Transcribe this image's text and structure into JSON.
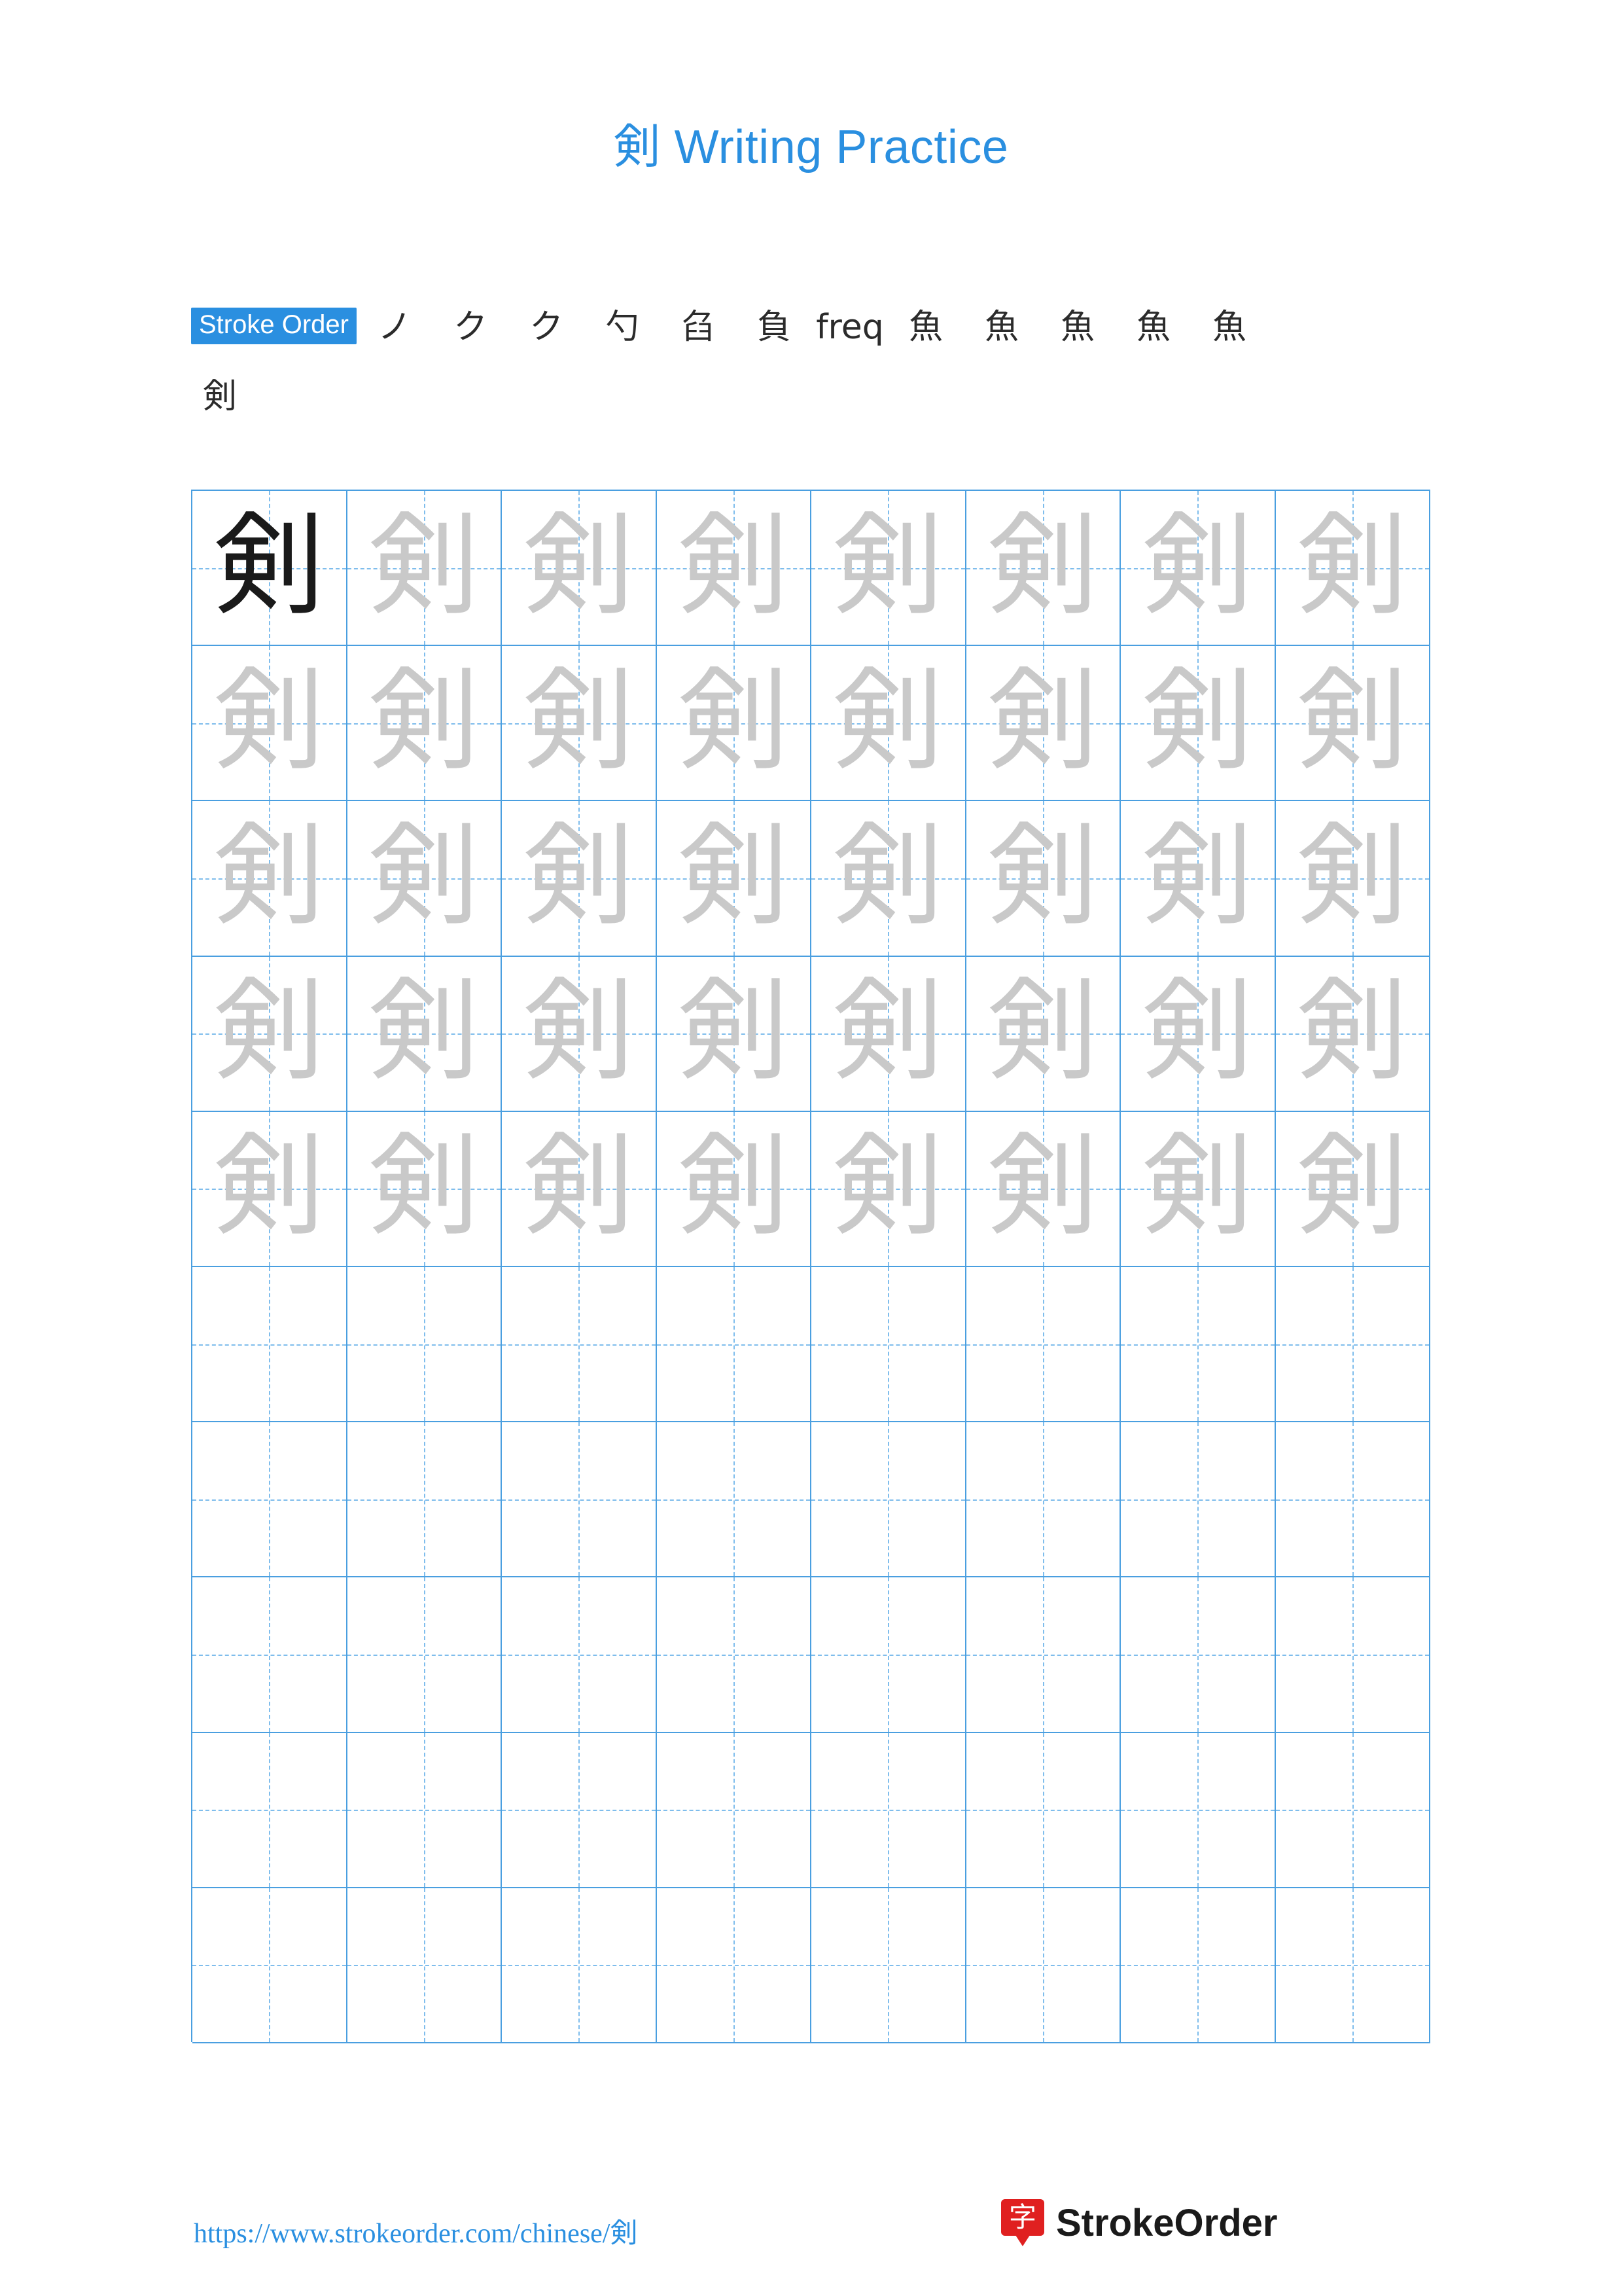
{
  "document": {
    "character": "剣",
    "title_suffix": " Writing Practice"
  },
  "stroke_order": {
    "label": "Stroke Order",
    "steps": [
      "ノ",
      "ク",
      "ク",
      "勺",
      "臽",
      "負",
      "freq",
      "魚",
      "魚",
      "魚",
      "魚",
      "魚",
      "剣"
    ],
    "step_count": 13
  },
  "grid": {
    "columns": 8,
    "rows": 10,
    "traced_rows": 5,
    "model_glyph": "剣",
    "practice_glyph": "剣",
    "blank_cell": ""
  },
  "footer": {
    "url": "https://www.strokeorder.com/chinese/剣",
    "brand_logo_char": "字",
    "brand_name": "StrokeOrder"
  }
}
